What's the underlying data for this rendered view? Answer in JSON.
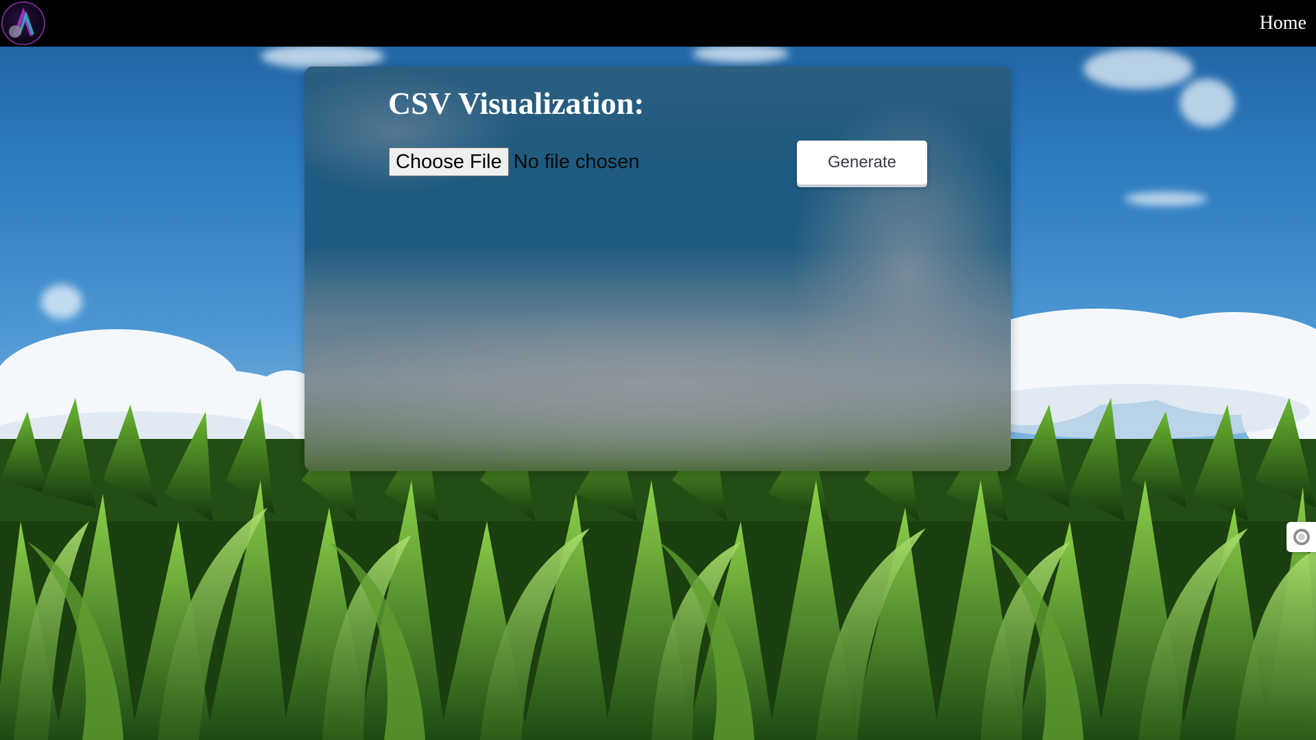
{
  "nav": {
    "logo_icon": "purple-letter-logo-icon",
    "home_label": "Home"
  },
  "card": {
    "title": "CSV Visualization:",
    "choose_file_label": "Choose File",
    "file_status": "No file chosen",
    "generate_label": "Generate"
  },
  "side_widget": {
    "icon": "circle-toggle-icon"
  },
  "colors": {
    "navbar": "#000000",
    "title_text": "#ffffff",
    "button_bg": "#ffffff",
    "logo_ring": "#6a2c8a"
  }
}
